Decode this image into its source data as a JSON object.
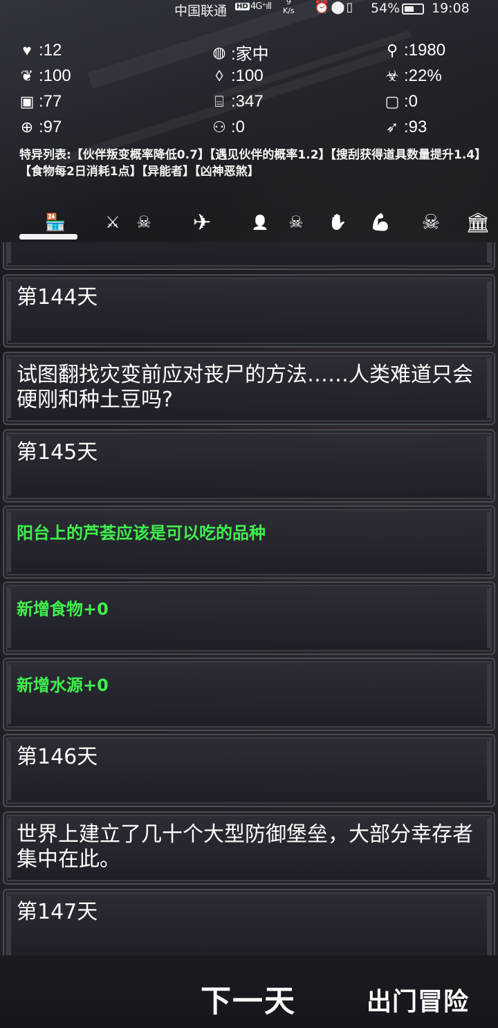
{
  "status_bar": {
    "carrier": "中国联通",
    "hd": "HD",
    "signal": "4G⁺ıll",
    "speed_value": "9",
    "speed_unit": "K/s",
    "icons": "⏰⬤▯",
    "battery": "54%",
    "time": "19:08"
  },
  "stats": {
    "health": {
      "icon": "heartbeat-icon",
      "value": ":12"
    },
    "location": {
      "icon": "globe-icon",
      "value": ":家中"
    },
    "year": {
      "icon": "pin-icon",
      "value": ":1980"
    },
    "hunger": {
      "icon": "stomach-icon",
      "value": ":100"
    },
    "thirst": {
      "icon": "drop-icon",
      "value": ":100"
    },
    "infection": {
      "icon": "biohazard-icon",
      "value": ":22%"
    },
    "food": {
      "icon": "food-icon",
      "value": ":77"
    },
    "water": {
      "icon": "bottle-icon",
      "value": ":347"
    },
    "material": {
      "icon": "jar-icon",
      "value": ":0"
    },
    "accuracy": {
      "icon": "crosshair-icon",
      "value": ":97"
    },
    "companions": {
      "icon": "people-icon",
      "value": ":0"
    },
    "agility": {
      "icon": "runner-icon",
      "value": ":93"
    }
  },
  "traits": "特异列表:【伙伴叛变概率降低0.7】【遇见伙伴的概率1.2】【搜刮获得道具数量提升1.4】【食物每2日消耗1点】【异能者】【凶神恶煞】",
  "tabs": [
    {
      "icon": "shop-icon",
      "glyph": "🏪"
    },
    {
      "icon": "weapons-icon",
      "glyph": "⚔"
    },
    {
      "icon": "skull-icon",
      "glyph": "☠"
    },
    {
      "icon": "airplane-icon",
      "glyph": "✈"
    },
    {
      "icon": "add-person-icon",
      "glyph": "👤"
    },
    {
      "icon": "skull-icon",
      "glyph": "☠"
    },
    {
      "icon": "hands-icon",
      "glyph": "✋"
    },
    {
      "icon": "muscle-icon",
      "glyph": "💪"
    },
    {
      "icon": "skull-icon",
      "glyph": "☠"
    },
    {
      "icon": "bank-icon",
      "glyph": "🏛"
    }
  ],
  "log": [
    {
      "text": "第144天",
      "color": "#ffffff"
    },
    {
      "text": "试图翻找灾变前应对丧尸的方法……人类难道只会硬刚和种土豆吗?",
      "color": "#ffffff"
    },
    {
      "text": "第145天",
      "color": "#ffffff"
    },
    {
      "text": "阳台上的芦荟应该是可以吃的品种",
      "color": "#3ff04d"
    },
    {
      "text": "新增食物+0",
      "color": "#3ff04d"
    },
    {
      "text": "新增水源+0",
      "color": "#3ff04d"
    },
    {
      "text": "第146天",
      "color": "#ffffff"
    },
    {
      "text": "世界上建立了几十个大型防御堡垒，大部分幸存者集中在此。",
      "color": "#ffffff"
    },
    {
      "text": "第147天",
      "color": "#ffffff"
    }
  ],
  "buttons": {
    "next_day": "下一天",
    "adventure": "出门冒险"
  }
}
